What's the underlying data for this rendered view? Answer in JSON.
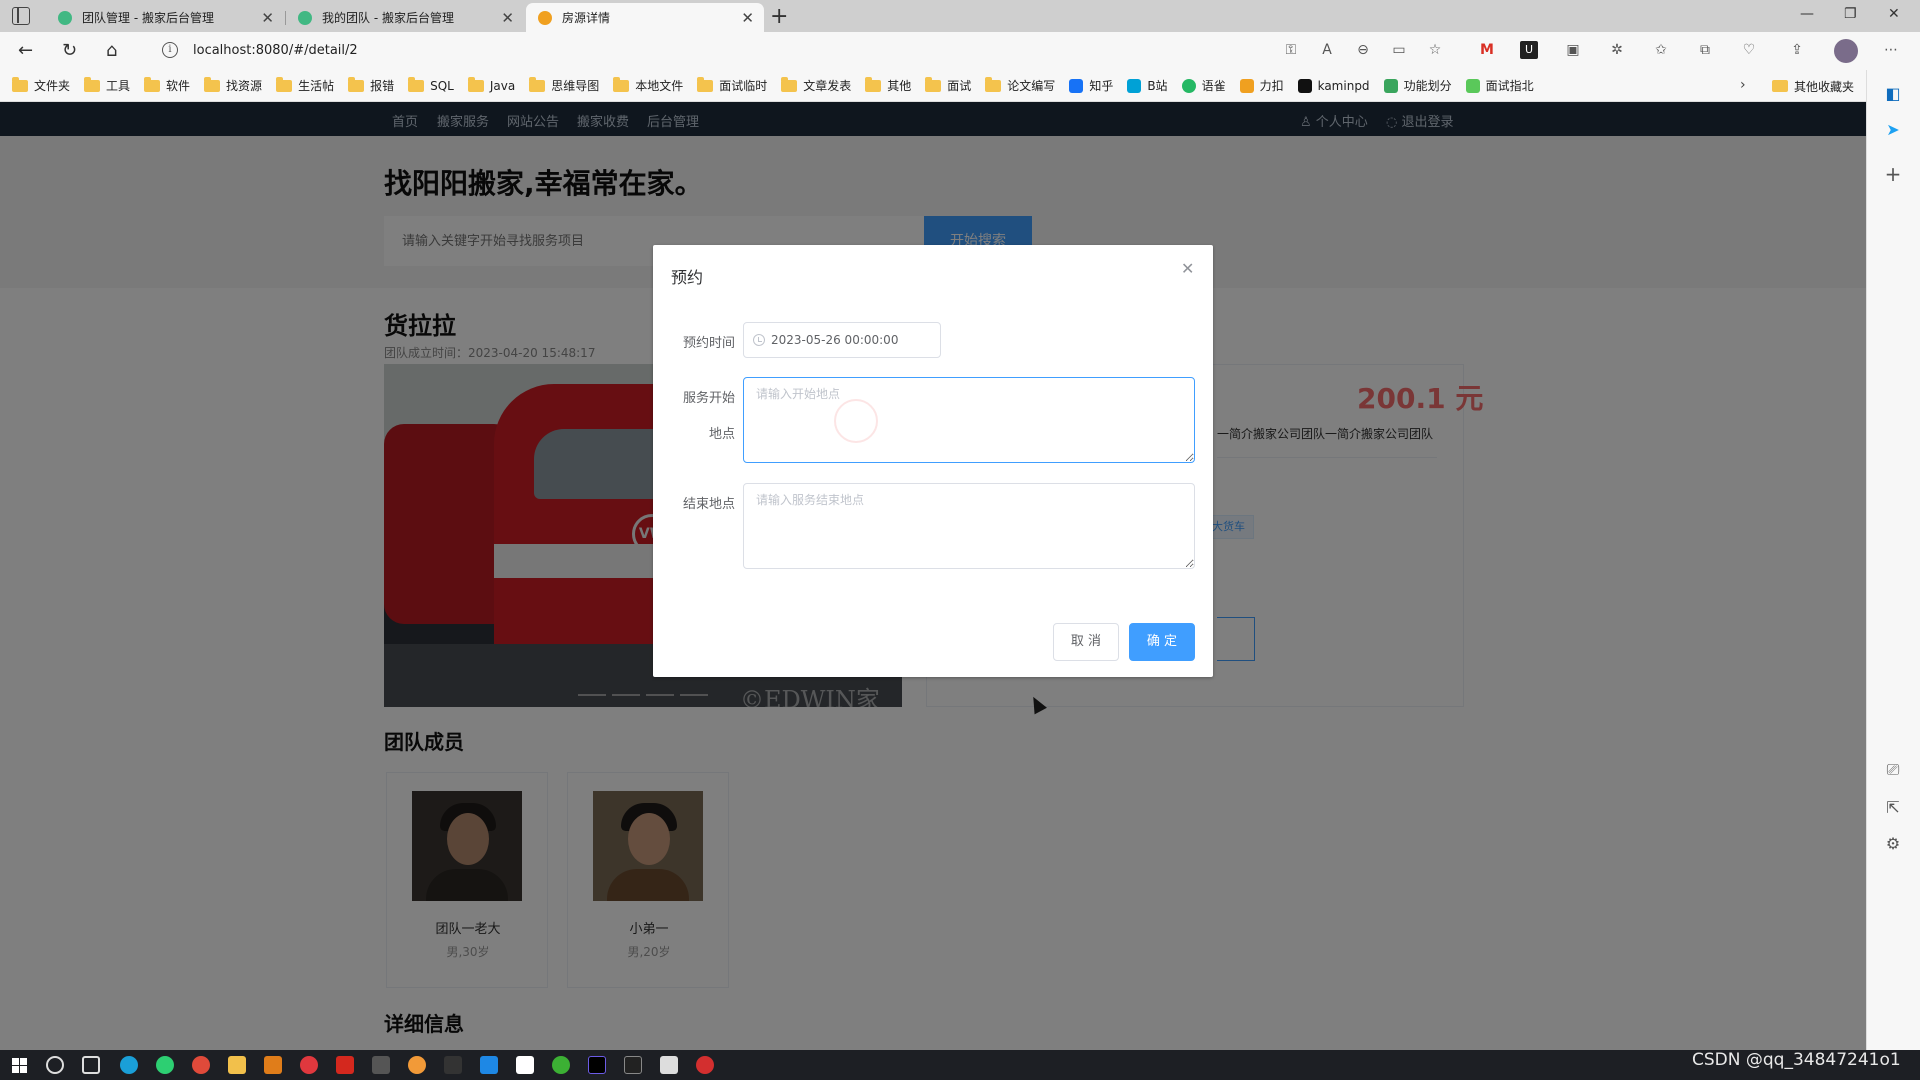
{
  "browser": {
    "tabs": [
      {
        "title": "团队管理 - 搬家后台管理",
        "active": false
      },
      {
        "title": "我的团队 - 搬家后台管理",
        "active": false
      },
      {
        "title": "房源详情",
        "active": true
      }
    ],
    "url": "localhost:8080/#/detail/2",
    "bookmarks": [
      "文件夹",
      "工具",
      "软件",
      "找资源",
      "生活帖",
      "报错",
      "SQL",
      "Java",
      "思维导图",
      "本地文件",
      "面试临时",
      "文章发表",
      "其他",
      "面试",
      "论文编写",
      "知乎",
      "B站",
      "语雀",
      "力扣",
      "kaminpd",
      "功能划分",
      "面试指北"
    ],
    "other_bookmarks": "其他收藏夹"
  },
  "site": {
    "nav": [
      "首页",
      "搬家服务",
      "网站公告",
      "搬家收费",
      "后台管理"
    ],
    "user_center": "个人中心",
    "logout": "退出登录",
    "slogan": "找阳阳搬家,幸福常在家。",
    "search_placeholder": "请输入关键字开始寻找服务项目",
    "search_button": "开始搜索",
    "team_name": "货拉拉",
    "team_founded": "团队成立时间：2023-04-20 15:48:17",
    "photo_watermark": "©EDWIN家",
    "price": "200.1 元",
    "intro": "一简介搬家公司团队一简介搬家公司团队",
    "tag": "大货车",
    "members_title": "团队成员",
    "members": [
      {
        "name": "团队一老大",
        "info": "男,30岁"
      },
      {
        "name": "小弟一",
        "info": "男,20岁"
      }
    ],
    "detail_title": "详细信息"
  },
  "dialog": {
    "title": "预约",
    "time_label": "预约时间",
    "time_value": "2023-05-26 00:00:00",
    "start_label_1": "服务开始",
    "start_label_2": "地点",
    "start_placeholder": "请输入开始地点",
    "end_label": "结束地点",
    "end_placeholder": "请输入服务结束地点",
    "cancel": "取 消",
    "confirm": "确 定"
  },
  "watermark": "CSDN @qq_34847241o1",
  "colors": {
    "primary": "#409eff",
    "price": "#f56c6c",
    "nav_bg": "#1f2d3d"
  }
}
